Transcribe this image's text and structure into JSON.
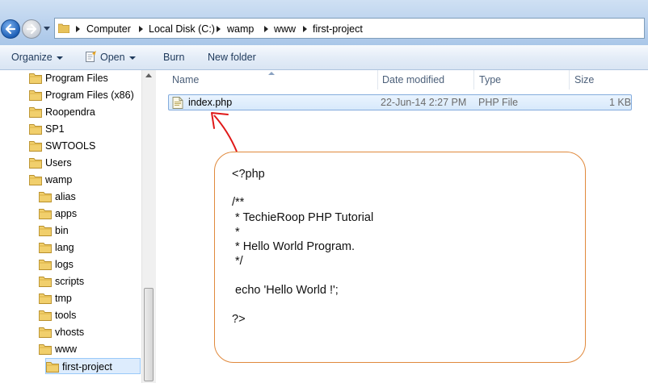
{
  "address_bar": {
    "segments": [
      "Computer",
      "Local Disk (C:)",
      "wamp",
      "www",
      "first-project"
    ]
  },
  "toolbar": {
    "organize_label": "Organize",
    "open_label": "Open",
    "burn_label": "Burn",
    "new_folder_label": "New folder"
  },
  "nav_tree": {
    "items": [
      {
        "label": "Program Files"
      },
      {
        "label": "Program Files (x86)"
      },
      {
        "label": "Roopendra"
      },
      {
        "label": "SP1"
      },
      {
        "label": "SWTOOLS"
      },
      {
        "label": "Users"
      },
      {
        "label": "wamp"
      },
      {
        "label": "alias"
      },
      {
        "label": "apps"
      },
      {
        "label": "bin"
      },
      {
        "label": "lang"
      },
      {
        "label": "logs"
      },
      {
        "label": "scripts"
      },
      {
        "label": "tmp"
      },
      {
        "label": "tools"
      },
      {
        "label": "vhosts"
      },
      {
        "label": "www"
      },
      {
        "label": "first-project"
      }
    ]
  },
  "file_list": {
    "columns": {
      "name": "Name",
      "date": "Date modified",
      "type": "Type",
      "size": "Size"
    },
    "rows": [
      {
        "name": "index.php",
        "date": "22-Jun-14 2:27 PM",
        "type": "PHP File",
        "size": "1 KB"
      }
    ]
  },
  "annotation": {
    "code_lines": [
      "<?php",
      "/**",
      " * TechieRoop PHP Tutorial",
      " *",
      " * Hello World Program.",
      " */",
      " echo 'Hello World !';",
      "?>"
    ],
    "border_color": "#e0893c",
    "arrow_color": "#e01818"
  }
}
